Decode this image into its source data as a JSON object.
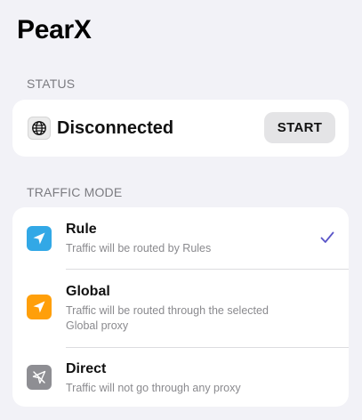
{
  "app": {
    "title": "PearX"
  },
  "status_section": {
    "header": "STATUS",
    "status_text": "Disconnected",
    "icon": "globe-icon",
    "start_label": "START"
  },
  "traffic_section": {
    "header": "TRAFFIC MODE",
    "selected": "Rule",
    "modes": [
      {
        "title": "Rule",
        "description": "Traffic will be routed by Rules",
        "icon": "location-arrow-icon",
        "icon_color": "#32a8e6",
        "selected": true
      },
      {
        "title": "Global",
        "description": "Traffic will be routed through the selected Global proxy",
        "icon": "location-arrow-icon",
        "icon_color": "#ff9f0a",
        "selected": false
      },
      {
        "title": "Direct",
        "description": "Traffic will not go through any proxy",
        "icon": "location-arrow-slash-icon",
        "icon_color": "#8e8e93",
        "selected": false
      }
    ],
    "check_color": "#5a55c8"
  }
}
